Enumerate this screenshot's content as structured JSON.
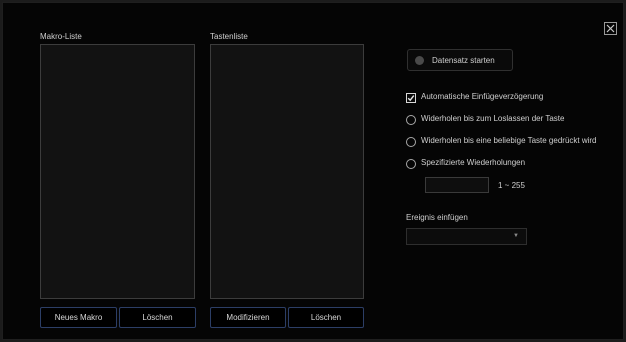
{
  "close_icon": "close-icon",
  "macro_list": {
    "label": "Makro-Liste",
    "new_button": "Neues Makro",
    "delete_button": "Löschen"
  },
  "key_list": {
    "label": "Tastenliste",
    "modify_button": "Modifizieren",
    "delete_button": "Löschen"
  },
  "record": {
    "label": "Datensatz starten"
  },
  "options": [
    {
      "label": "Automatische Einfügeverzögerung",
      "type": "checkbox",
      "checked": true
    },
    {
      "label": "Widerholen bis zum Loslassen der Taste",
      "type": "radio",
      "checked": false
    },
    {
      "label": "Widerholen bis eine beliebige Taste gedrückt wird",
      "type": "radio",
      "checked": false
    },
    {
      "label": "Spezifizierte Wiederholungen",
      "type": "radio",
      "checked": false
    }
  ],
  "repetitions": {
    "value": "",
    "range": "1 ~ 255"
  },
  "event": {
    "label": "Ereignis einfügen",
    "selected": ""
  },
  "colors": {
    "accent_border": "#2c3e66",
    "background": "#050505",
    "list_bg": "#121212"
  }
}
